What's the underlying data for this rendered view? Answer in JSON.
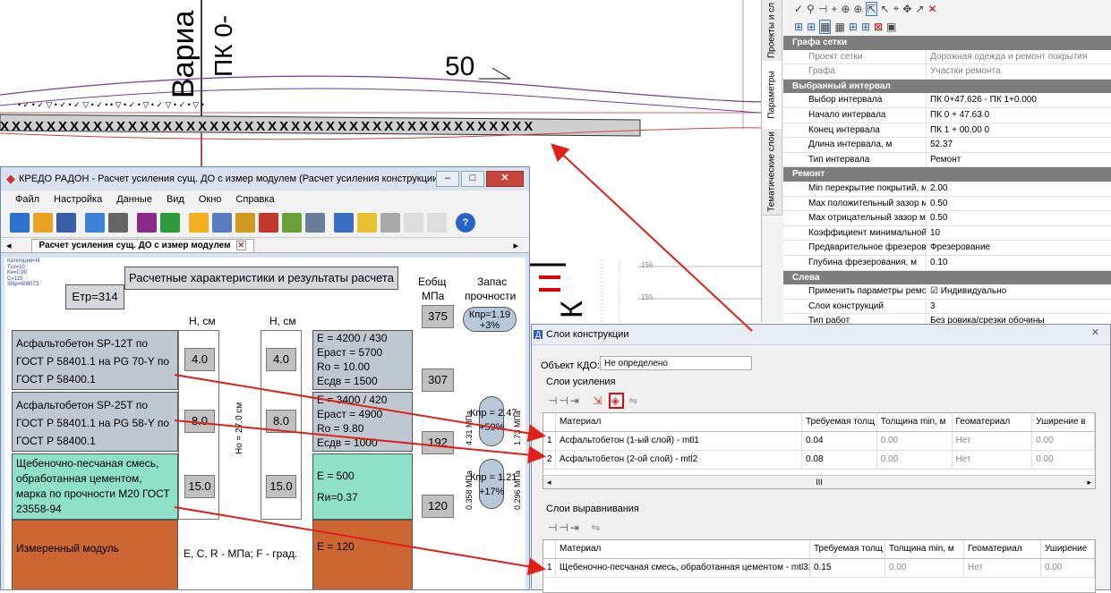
{
  "cad": {
    "variant_text": "Вариа",
    "pk_text": "ПК 0-",
    "num_50": "50",
    "right_ticks": [
      "156",
      "155"
    ],
    "bg_letters": "К"
  },
  "right_panel": {
    "vtabs": [
      "Проекты и сл",
      "Параметры",
      "Тематические слои"
    ],
    "sections": [
      {
        "title": "Графа сетки",
        "rows": [
          {
            "k": "Проект сетки",
            "v": "Дорожная одежда и ремонт покрытия",
            "grey": true
          },
          {
            "k": "Графа",
            "v": "Участки ремонта",
            "grey": true
          }
        ]
      },
      {
        "title": "Выбранный интервал",
        "rows": [
          {
            "k": "Выбор интервала",
            "v": "ПК 0+47.626 - ПК 1+0.000"
          },
          {
            "k": "Начало интервала",
            "v": "ПК     0 + 47.63  0"
          },
          {
            "k": "Конец интервала",
            "v": "ПК     1 + 00.00  0"
          },
          {
            "k": "Длина интервала, м",
            "v": "52.37"
          },
          {
            "k": "Тип интервала",
            "v": "Ремонт"
          }
        ]
      },
      {
        "title": "Ремонт",
        "rows": [
          {
            "k": "Min перекрытие покрытий, м",
            "v": "2.00"
          },
          {
            "k": "Max положительный зазор м...",
            "v": "0.50"
          },
          {
            "k": "Max отрицательный зазор ме...",
            "v": "0.50"
          },
          {
            "k": "Коэффициент минимальной д...",
            "v": "10"
          },
          {
            "k": "Предварительное фрезеров...",
            "v": "Фрезерование"
          },
          {
            "k": "Глубина фрезерования, м",
            "v": "0.10"
          }
        ]
      },
      {
        "title": "Слева",
        "rows": [
          {
            "k": "Применить параметры ремонта",
            "v": "Индивидуально"
          },
          {
            "k": "Слои конструкций",
            "v": "3"
          },
          {
            "k": "Тип работ",
            "v": "Без ровика/срезки обочины"
          }
        ]
      }
    ]
  },
  "main_window": {
    "title": "КРЕДО РАДОН - Расчет усиления сущ. ДО с измер модулем (Расчет усиления конструкции сущес...",
    "menu": [
      "Файл",
      "Настройка",
      "Данные",
      "Вид",
      "Окно",
      "Справка"
    ],
    "tab_label": "Расчет усиления сущ. ДО с измер модулем",
    "calc": {
      "params": [
        "Категория=III",
        "Тсп=10",
        "Кн=0.90",
        "С=115",
        "SNp=908073"
      ],
      "etr": "Етр=314",
      "header": "Расчетные характеристики и результаты расчета",
      "col_eobsh": "Еобщ",
      "col_mpa": "МПа",
      "col_zapas1": "Запас",
      "col_zapas2": "прочности",
      "h_cm_1": "Н, см",
      "h_cm_2": "Н, см",
      "knp_top": "Кпр=1.19",
      "knp_top_pct": "+3%",
      "e_375": "375",
      "e_307": "307",
      "e_192": "192",
      "e_120": "120",
      "layer1": "Асфальтобетон SP-12Т по ГОСТ Р 58401.1 на PG 70-Y по ГОСТ Р 58400.1",
      "layer2": "Асфальтобетон SP-25Т по ГОСТ Р 58401.1 на PG 58-Y по ГОСТ Р 58400.1",
      "layer3": "Щебеночно-песчаная смесь, обработанная цементом, марка по прочности М20 ГОСТ 23558-94",
      "layer4": "Измеренный модуль",
      "h1a": "4.0",
      "h1b": "4.0",
      "h2a": "8.0",
      "h2b": "8.0",
      "h3a": "15.0",
      "h3b": "15.0",
      "props1": [
        "Е = 4200 / 430",
        "Еpaст = 5700",
        "Ro = 10.00",
        "Есдв = 1500"
      ],
      "props2": [
        "Е = 3400 / 420",
        "Еpaст = 4900",
        "Ro = 9.80",
        "Есдв = 1000"
      ],
      "props3": [
        "Е = 500",
        "Rи=0.37"
      ],
      "props4": [
        "Е = 120"
      ],
      "ho": "Но = 27.0 см",
      "knp2": "Кпр = 2.47",
      "knp2_pct": "+59%",
      "knp2_l": "4.31 МПа",
      "knp2_r": "1.73 МПа",
      "knp3": "Кпр = 1.21",
      "knp3_pct": "+17%",
      "knp3_l": "0.358 МПа",
      "knp3_r": "0.296 МПа",
      "legend": "Е, С, R - МПа; F - град."
    }
  },
  "dialog": {
    "title": "Слои конструкции",
    "object_label": "Объект КДО:",
    "object_value": "Не определено",
    "group1": "Слои усиления",
    "group2": "Слои выравнивания",
    "columns1": [
      "Материал",
      "Требуемая толщ",
      "Толщина min, м",
      "Геоматериал",
      "Уширение в"
    ],
    "rows1": [
      [
        "1",
        "Асфальтобетон (1-ый слой) - mtl1",
        "0.04",
        "0.00",
        "Нет",
        "0.00"
      ],
      [
        "2",
        "Асфальтобетон (2-ой слой) - mtl2",
        "0.08",
        "0.00",
        "Нет",
        "0.00"
      ]
    ],
    "columns2": [
      "Материал",
      "Требуемая толщ",
      "Толщина min, м",
      "Геоматериал",
      "Уширение"
    ],
    "rows2": [
      [
        "1",
        "Щебеночно-песчаная смесь, обработанная цементом - mtl32",
        "0.15",
        "0.00",
        "Нет",
        "0.00"
      ]
    ],
    "scroll_mark": "III"
  },
  "colors": {
    "asphalt": "#bfc7d0",
    "cement": "#8fe0c8",
    "subgrade": "#cc6633",
    "arrow": "#e0201a",
    "panel_head": "#7d7d7d"
  }
}
